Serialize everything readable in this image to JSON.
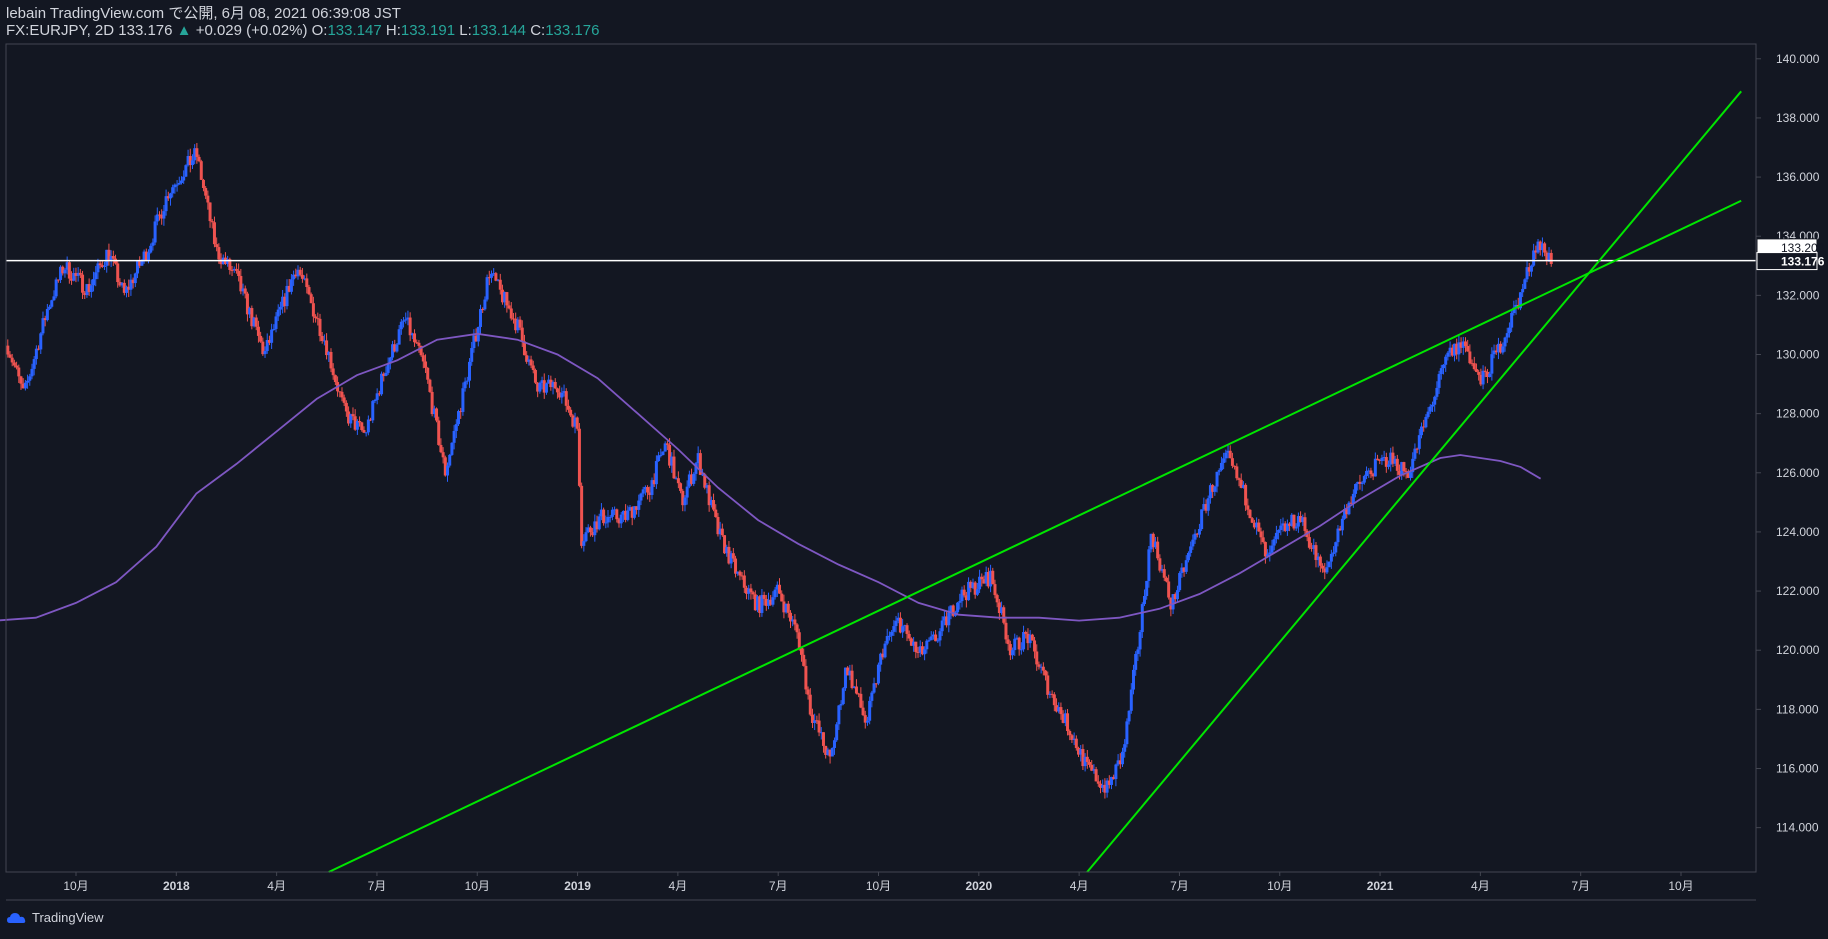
{
  "header": {
    "line1": "lebain TradingView.com で公開, 6月 08, 2021 06:39:08 JST",
    "symbol": "FX:EURJPY, 2D 133.176",
    "change_arrow": "▲",
    "change": "+0.029 (+0.02%)",
    "o_label": "O:",
    "o_value": "133.147",
    "h_label": "H:",
    "h_value": "133.191",
    "l_label": "L:",
    "l_value": "133.144",
    "c_label": "C:",
    "c_value": "133.176"
  },
  "footer": {
    "brand": "TradingView"
  },
  "colors": {
    "background": "#131722",
    "up": "#2962ff",
    "down": "#ef5350",
    "ma": "#7e57c2",
    "trendline": "#00e600",
    "hline": "#ffffff"
  },
  "chart_data": {
    "type": "candlestick",
    "symbol": "FX:EURJPY",
    "timeframe": "2D",
    "ylim": [
      112.5,
      140.5
    ],
    "y_ticks": [
      "140.000",
      "138.000",
      "136.000",
      "134.000",
      "132.000",
      "130.000",
      "128.000",
      "126.000",
      "124.000",
      "122.000",
      "120.000",
      "118.000",
      "116.000",
      "114.000"
    ],
    "x_ticks": [
      {
        "label": "10月",
        "t": 2017.75,
        "bold": false
      },
      {
        "label": "2018",
        "t": 2018.0,
        "bold": true
      },
      {
        "label": "4月",
        "t": 2018.25,
        "bold": false
      },
      {
        "label": "7月",
        "t": 2018.5,
        "bold": false
      },
      {
        "label": "10月",
        "t": 2018.75,
        "bold": false
      },
      {
        "label": "2019",
        "t": 2019.0,
        "bold": true
      },
      {
        "label": "4月",
        "t": 2019.25,
        "bold": false
      },
      {
        "label": "7月",
        "t": 2019.5,
        "bold": false
      },
      {
        "label": "10月",
        "t": 2019.75,
        "bold": false
      },
      {
        "label": "2020",
        "t": 2020.0,
        "bold": true
      },
      {
        "label": "4月",
        "t": 2020.25,
        "bold": false
      },
      {
        "label": "7月",
        "t": 2020.5,
        "bold": false
      },
      {
        "label": "10月",
        "t": 2020.75,
        "bold": false
      },
      {
        "label": "2021",
        "t": 2021.0,
        "bold": true
      },
      {
        "label": "4月",
        "t": 2021.25,
        "bold": false
      },
      {
        "label": "7月",
        "t": 2021.5,
        "bold": false
      },
      {
        "label": "10月",
        "t": 2021.75,
        "bold": false
      }
    ],
    "price_path": [
      [
        2017.58,
        130.3
      ],
      [
        2017.62,
        128.6
      ],
      [
        2017.68,
        131.6
      ],
      [
        2017.72,
        133.0
      ],
      [
        2017.78,
        132.2
      ],
      [
        2017.83,
        133.5
      ],
      [
        2017.87,
        132.0
      ],
      [
        2017.93,
        133.6
      ],
      [
        2017.98,
        135.5
      ],
      [
        2018.05,
        136.8
      ],
      [
        2018.1,
        133.5
      ],
      [
        2018.15,
        132.6
      ],
      [
        2018.22,
        130.0
      ],
      [
        2018.3,
        133.0
      ],
      [
        2018.37,
        130.5
      ],
      [
        2018.42,
        128.0
      ],
      [
        2018.47,
        127.3
      ],
      [
        2018.52,
        129.5
      ],
      [
        2018.57,
        131.2
      ],
      [
        2018.62,
        129.5
      ],
      [
        2018.67,
        126.0
      ],
      [
        2018.72,
        129.0
      ],
      [
        2018.78,
        132.8
      ],
      [
        2018.85,
        131.0
      ],
      [
        2018.9,
        128.8
      ],
      [
        2018.95,
        129.0
      ],
      [
        2019.0,
        127.5
      ],
      [
        2019.01,
        123.8
      ],
      [
        2019.06,
        124.5
      ],
      [
        2019.12,
        124.5
      ],
      [
        2019.18,
        125.5
      ],
      [
        2019.22,
        127.0
      ],
      [
        2019.26,
        125.0
      ],
      [
        2019.3,
        126.5
      ],
      [
        2019.35,
        124.0
      ],
      [
        2019.4,
        122.5
      ],
      [
        2019.45,
        121.5
      ],
      [
        2019.5,
        122.0
      ],
      [
        2019.55,
        120.5
      ],
      [
        2019.58,
        118.0
      ],
      [
        2019.63,
        116.2
      ],
      [
        2019.67,
        119.5
      ],
      [
        2019.72,
        117.5
      ],
      [
        2019.76,
        120.0
      ],
      [
        2019.8,
        121.0
      ],
      [
        2019.85,
        119.8
      ],
      [
        2019.9,
        120.5
      ],
      [
        2019.95,
        121.8
      ],
      [
        2020.03,
        122.5
      ],
      [
        2020.08,
        120.0
      ],
      [
        2020.12,
        120.5
      ],
      [
        2020.18,
        118.5
      ],
      [
        2020.22,
        117.5
      ],
      [
        2020.27,
        116.0
      ],
      [
        2020.32,
        115.3
      ],
      [
        2020.36,
        116.5
      ],
      [
        2020.4,
        120.5
      ],
      [
        2020.43,
        124.0
      ],
      [
        2020.48,
        121.5
      ],
      [
        2020.53,
        123.5
      ],
      [
        2020.58,
        125.5
      ],
      [
        2020.62,
        126.5
      ],
      [
        2020.67,
        125.0
      ],
      [
        2020.72,
        123.0
      ],
      [
        2020.75,
        124.0
      ],
      [
        2020.8,
        124.5
      ],
      [
        2020.86,
        122.5
      ],
      [
        2020.92,
        125.0
      ],
      [
        2020.97,
        126.0
      ],
      [
        2021.02,
        126.5
      ],
      [
        2021.07,
        126.0
      ],
      [
        2021.12,
        128.0
      ],
      [
        2021.17,
        130.0
      ],
      [
        2021.21,
        130.4
      ],
      [
        2021.25,
        129.0
      ],
      [
        2021.3,
        130.3
      ],
      [
        2021.35,
        132.0
      ],
      [
        2021.39,
        133.8
      ],
      [
        2021.43,
        133.18
      ]
    ],
    "ma200": [
      [
        2017.55,
        121.0
      ],
      [
        2017.65,
        121.1
      ],
      [
        2017.75,
        121.6
      ],
      [
        2017.85,
        122.3
      ],
      [
        2017.95,
        123.5
      ],
      [
        2018.05,
        125.3
      ],
      [
        2018.15,
        126.3
      ],
      [
        2018.25,
        127.4
      ],
      [
        2018.35,
        128.5
      ],
      [
        2018.45,
        129.3
      ],
      [
        2018.55,
        129.8
      ],
      [
        2018.65,
        130.5
      ],
      [
        2018.75,
        130.7
      ],
      [
        2018.85,
        130.5
      ],
      [
        2018.95,
        130.0
      ],
      [
        2019.05,
        129.2
      ],
      [
        2019.15,
        128.0
      ],
      [
        2019.25,
        126.8
      ],
      [
        2019.35,
        125.5
      ],
      [
        2019.45,
        124.4
      ],
      [
        2019.55,
        123.6
      ],
      [
        2019.65,
        122.9
      ],
      [
        2019.75,
        122.3
      ],
      [
        2019.85,
        121.6
      ],
      [
        2019.95,
        121.2
      ],
      [
        2020.05,
        121.1
      ],
      [
        2020.15,
        121.1
      ],
      [
        2020.25,
        121.0
      ],
      [
        2020.35,
        121.1
      ],
      [
        2020.45,
        121.4
      ],
      [
        2020.55,
        121.9
      ],
      [
        2020.65,
        122.6
      ],
      [
        2020.75,
        123.4
      ],
      [
        2020.85,
        124.2
      ],
      [
        2020.95,
        125.1
      ],
      [
        2021.05,
        125.9
      ],
      [
        2021.15,
        126.5
      ],
      [
        2021.2,
        126.6
      ],
      [
        2021.3,
        126.4
      ],
      [
        2021.35,
        126.2
      ],
      [
        2021.4,
        125.8
      ]
    ],
    "horizontal_line": 133.176,
    "trendlines": [
      {
        "p1": [
          2018.38,
          112.5
        ],
        "p2": [
          2021.9,
          135.2
        ]
      },
      {
        "p1": [
          2020.27,
          112.5
        ],
        "p2": [
          2021.9,
          138.9
        ]
      }
    ],
    "last_price_labels": [
      "133.200",
      "133.176"
    ]
  }
}
